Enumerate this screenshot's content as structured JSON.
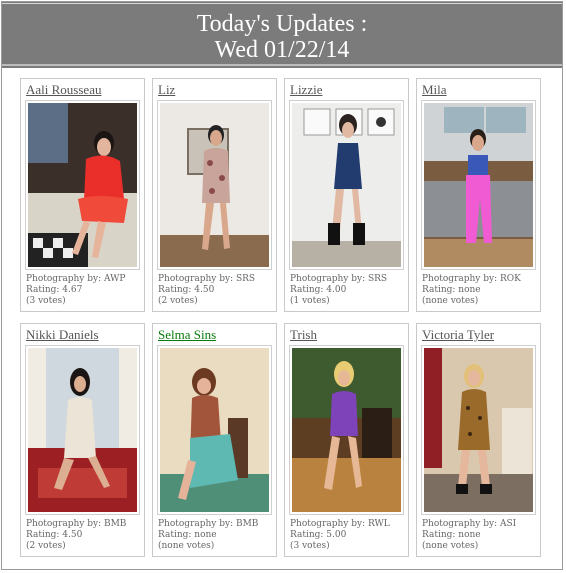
{
  "header": {
    "title_line1": "Today's Updates :",
    "title_line2": "Wed 01/22/14"
  },
  "cards": [
    {
      "name": "Aali Rousseau",
      "photography": "Photography by: AWP",
      "rating": "Rating: 4.67",
      "votes": "(3 votes)",
      "image": "model-photo"
    },
    {
      "name": "Liz",
      "photography": "Photography by: SRS",
      "rating": "Rating: 4.50",
      "votes": "(2 votes)",
      "image": "model-photo"
    },
    {
      "name": "Lizzie",
      "photography": "Photography by: SRS",
      "rating": "Rating: 4.00",
      "votes": "(1 votes)",
      "image": "model-photo"
    },
    {
      "name": "Mila",
      "photography": "Photography by: ROK",
      "rating": "Rating: none",
      "votes": "(none votes)",
      "image": "model-photo"
    },
    {
      "name": "Nikki Daniels",
      "photography": "Photography by: BMB",
      "rating": "Rating: 4.50",
      "votes": "(2 votes)",
      "image": "model-photo"
    },
    {
      "name": "Selma Sins",
      "photography": "Photography by: BMB",
      "rating": "Rating: none",
      "votes": "(none votes)",
      "image": "model-photo"
    },
    {
      "name": "Trish",
      "photography": "Photography by: RWL",
      "rating": "Rating: 5.00",
      "votes": "(3 votes)",
      "image": "model-photo"
    },
    {
      "name": "Victoria Tyler",
      "photography": "Photography by: ASI",
      "rating": "Rating: none",
      "votes": "(none votes)",
      "image": "model-photo"
    }
  ],
  "colors": {
    "header_bg": "#7b7b7b",
    "link_default": "#555555",
    "link_visited_green": "#0a7a0a"
  }
}
